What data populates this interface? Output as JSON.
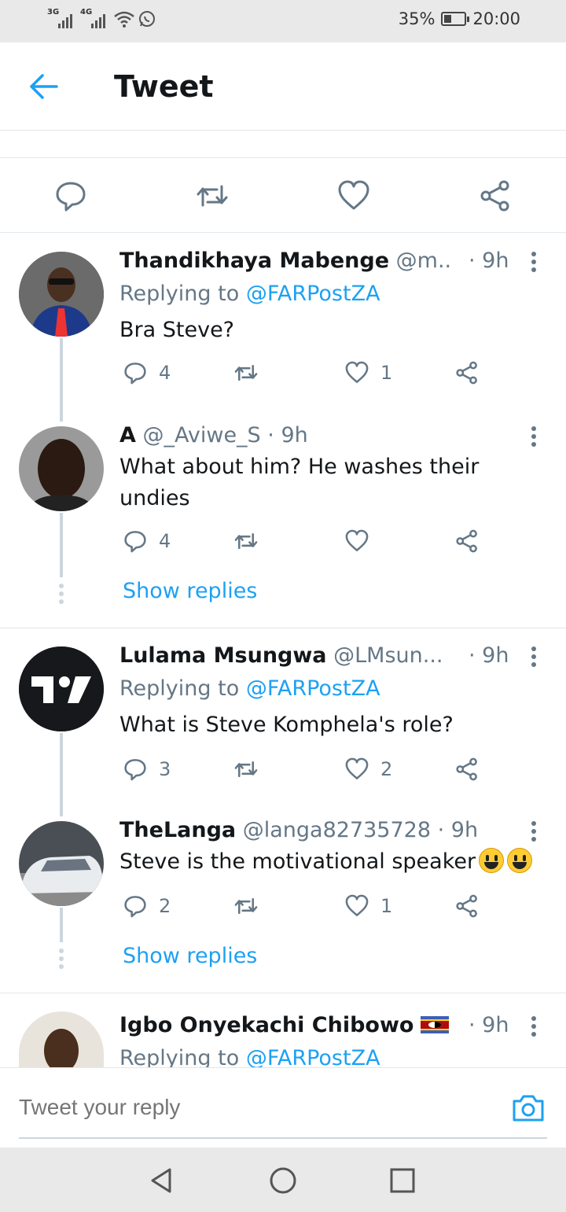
{
  "status_bar": {
    "network1": "3G",
    "network2": "4G",
    "battery": "35%",
    "battery_level": 0.35,
    "time": "20:00"
  },
  "header": {
    "title": "Tweet"
  },
  "tweets": [
    {
      "name": "Thandikhaya Mabenge",
      "handle": "@m...",
      "time": "· 9h",
      "replying_prefix": "Replying to ",
      "replying_to": "@FARPostZA",
      "text": "Bra Steve?",
      "replies": "4",
      "retweets": "",
      "likes": "1"
    },
    {
      "name": "A",
      "handle": "@_Aviwe_S",
      "time": "· 9h",
      "text_line1": "What about him? He washes their",
      "text_line2": "undies",
      "replies": "4",
      "retweets": "",
      "likes": "",
      "show_replies": "Show replies"
    },
    {
      "name": "Lulama Msungwa",
      "handle": "@LMsun...",
      "time": "· 9h",
      "replying_prefix": "Replying to ",
      "replying_to": "@FARPostZA",
      "text": "What is Steve Komphela's role?",
      "replies": "3",
      "retweets": "",
      "likes": "2"
    },
    {
      "name": "TheLanga",
      "handle": "@langa82735728",
      "time": "· 9h",
      "text": "Steve is the motivational speaker",
      "replies": "2",
      "retweets": "",
      "likes": "1",
      "show_replies": "Show replies"
    },
    {
      "name": "Igbo Onyekachi Chibowo",
      "handle": "",
      "time": "· 9h",
      "replying_prefix": "Replying to ",
      "replying_to": "@FARPostZA"
    }
  ],
  "reply_bar": {
    "placeholder": "Tweet your reply"
  }
}
